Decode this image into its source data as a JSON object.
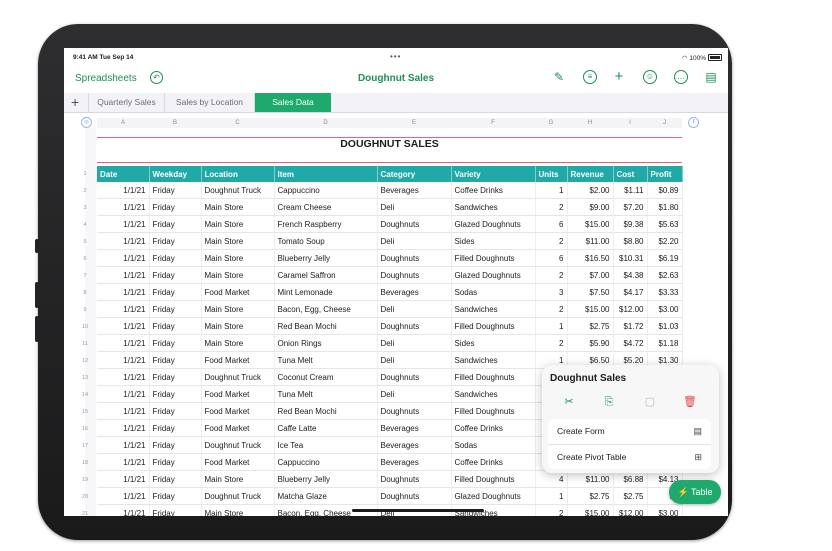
{
  "status": {
    "time": "9:41 AM  Tue Sep 14",
    "battery": "100%"
  },
  "toolbar": {
    "back_label": "Spreadsheets",
    "title": "Doughnut Sales"
  },
  "tabs": [
    "Quarterly Sales",
    "Sales by Location",
    "Sales Data"
  ],
  "active_tab": "Sales Data",
  "columns_letters": [
    "A",
    "B",
    "C",
    "D",
    "E",
    "F",
    "G",
    "H",
    "I",
    "J"
  ],
  "sheet_title": "DOUGHNUT SALES",
  "table": {
    "headers": [
      "Date",
      "Weekday",
      "Location",
      "Item",
      "Category",
      "Variety",
      "Units",
      "Revenue",
      "Cost",
      "Profit"
    ],
    "rows": [
      [
        "1/1/21",
        "Friday",
        "Doughnut Truck",
        "Cappuccino",
        "Beverages",
        "Coffee Drinks",
        "1",
        "$2.00",
        "$1.11",
        "$0.89"
      ],
      [
        "1/1/21",
        "Friday",
        "Main Store",
        "Cream Cheese",
        "Deli",
        "Sandwiches",
        "2",
        "$9.00",
        "$7.20",
        "$1.80"
      ],
      [
        "1/1/21",
        "Friday",
        "Main Store",
        "French Raspberry",
        "Doughnuts",
        "Glazed Doughnuts",
        "6",
        "$15.00",
        "$9.38",
        "$5.63"
      ],
      [
        "1/1/21",
        "Friday",
        "Main Store",
        "Tomato Soup",
        "Deli",
        "Sides",
        "2",
        "$11.00",
        "$8.80",
        "$2.20"
      ],
      [
        "1/1/21",
        "Friday",
        "Main Store",
        "Blueberry Jelly",
        "Doughnuts",
        "Filled Doughnuts",
        "6",
        "$16.50",
        "$10.31",
        "$6.19"
      ],
      [
        "1/1/21",
        "Friday",
        "Main Store",
        "Caramel Saffron",
        "Doughnuts",
        "Glazed Doughnuts",
        "2",
        "$7.00",
        "$4.38",
        "$2.63"
      ],
      [
        "1/1/21",
        "Friday",
        "Food Market",
        "Mint Lemonade",
        "Beverages",
        "Sodas",
        "3",
        "$7.50",
        "$4.17",
        "$3.33"
      ],
      [
        "1/1/21",
        "Friday",
        "Main Store",
        "Bacon, Egg, Cheese",
        "Deli",
        "Sandwiches",
        "2",
        "$15.00",
        "$12.00",
        "$3.00"
      ],
      [
        "1/1/21",
        "Friday",
        "Main Store",
        "Red Bean Mochi",
        "Doughnuts",
        "Filled Doughnuts",
        "1",
        "$2.75",
        "$1.72",
        "$1.03"
      ],
      [
        "1/1/21",
        "Friday",
        "Main Store",
        "Onion Rings",
        "Deli",
        "Sides",
        "2",
        "$5.90",
        "$4.72",
        "$1.18"
      ],
      [
        "1/1/21",
        "Friday",
        "Food Market",
        "Tuna Melt",
        "Deli",
        "Sandwiches",
        "1",
        "$6.50",
        "$5.20",
        "$1.30"
      ],
      [
        "1/1/21",
        "Friday",
        "Doughnut Truck",
        "Coconut Cream",
        "Doughnuts",
        "Filled Doughnuts",
        "",
        "",
        "",
        ""
      ],
      [
        "1/1/21",
        "Friday",
        "Food Market",
        "Tuna Melt",
        "Deli",
        "Sandwiches",
        "",
        "",
        "",
        ""
      ],
      [
        "1/1/21",
        "Friday",
        "Food Market",
        "Red Bean Mochi",
        "Doughnuts",
        "Filled Doughnuts",
        "",
        "",
        "",
        ""
      ],
      [
        "1/1/21",
        "Friday",
        "Food Market",
        "Caffe Latte",
        "Beverages",
        "Coffee Drinks",
        "",
        "",
        "",
        ""
      ],
      [
        "1/1/21",
        "Friday",
        "Doughnut Truck",
        "Ice Tea",
        "Beverages",
        "Sodas",
        "",
        "",
        "",
        ""
      ],
      [
        "1/1/21",
        "Friday",
        "Food Market",
        "Cappuccino",
        "Beverages",
        "Coffee Drinks",
        "",
        "",
        "",
        ""
      ],
      [
        "1/1/21",
        "Friday",
        "Main Store",
        "Blueberry Jelly",
        "Doughnuts",
        "Filled Doughnuts",
        "4",
        "$11.00",
        "$6.88",
        "$4.13"
      ],
      [
        "1/1/21",
        "Friday",
        "Doughnut Truck",
        "Matcha Glaze",
        "Doughnuts",
        "Glazed Doughnuts",
        "1",
        "$2.75",
        "$2.75",
        "$1"
      ],
      [
        "1/1/21",
        "Friday",
        "Main Store",
        "Bacon, Egg, Cheese",
        "Deli",
        "Sandwiches",
        "2",
        "$15.00",
        "$12.00",
        "$3.00"
      ]
    ]
  },
  "row_numbers": [
    "1",
    "2",
    "3",
    "4",
    "5",
    "6",
    "7",
    "8",
    "9",
    "10",
    "11",
    "12",
    "13",
    "14",
    "15",
    "16",
    "17",
    "18",
    "19",
    "20",
    "21"
  ],
  "popover": {
    "title": "Doughnut Sales",
    "items": [
      {
        "label": "Create Form",
        "icon": "form-icon"
      },
      {
        "label": "Create Pivot Table",
        "icon": "pivot-table-icon"
      }
    ]
  },
  "table_button": {
    "label": "Table"
  },
  "colors": {
    "accent": "#1eaa6d",
    "header": "#20a9a7",
    "title_line": "#e0657c"
  }
}
